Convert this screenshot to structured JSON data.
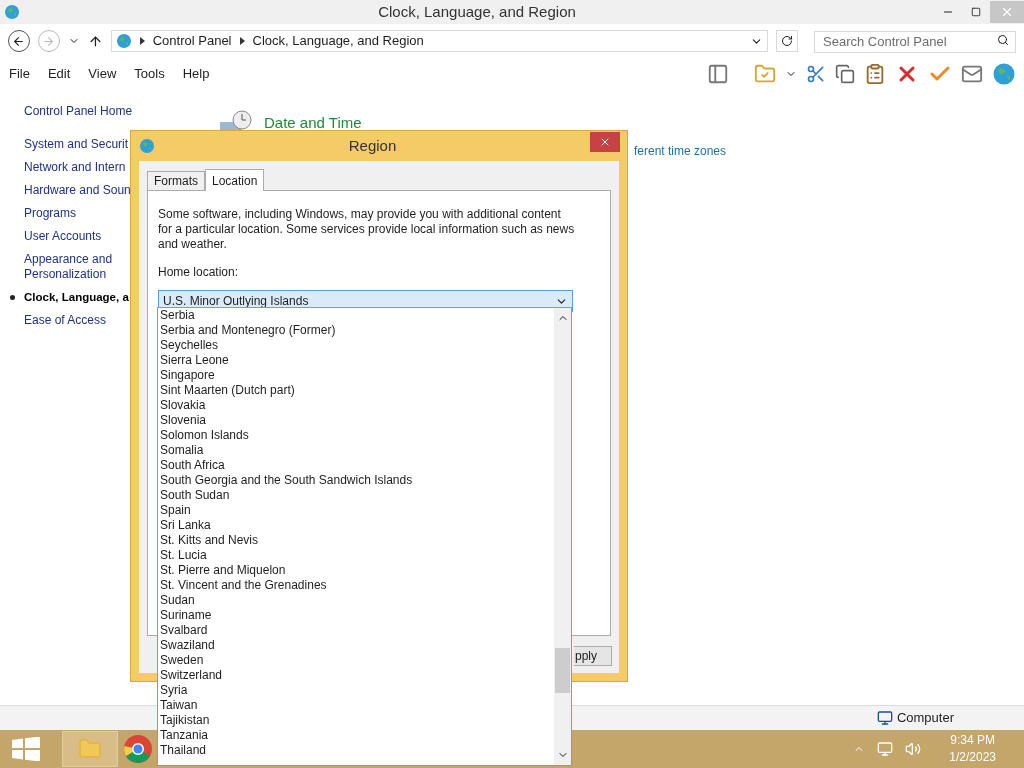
{
  "window": {
    "title": "Clock, Language, and Region"
  },
  "address_bar": {
    "breadcrumbs": [
      "Control Panel",
      "Clock, Language, and Region"
    ]
  },
  "search": {
    "placeholder": "Search Control Panel"
  },
  "menu": [
    "File",
    "Edit",
    "View",
    "Tools",
    "Help"
  ],
  "sidebar": {
    "items": [
      {
        "label": "Control Panel Home",
        "selected": false
      },
      {
        "label": "System and Securit",
        "selected": false
      },
      {
        "label": "Network and Intern",
        "selected": false
      },
      {
        "label": "Hardware and Soun",
        "selected": false
      },
      {
        "label": "Programs",
        "selected": false
      },
      {
        "label": "User Accounts",
        "selected": false
      },
      {
        "label": "Appearance and Personalization",
        "selected": false
      },
      {
        "label": "Clock, Language, a",
        "selected": true
      },
      {
        "label": "Ease of Access",
        "selected": false
      }
    ]
  },
  "main": {
    "heading": "Date and Time",
    "link": "ferent time zones"
  },
  "dialog": {
    "title": "Region",
    "tabs": [
      {
        "label": "Formats",
        "selected": false
      },
      {
        "label": "Location",
        "selected": true
      }
    ],
    "description": "Some software, including Windows, may provide you with additional content for a particular location. Some services provide local information such as news and weather.",
    "field_label": "Home location:",
    "combo": {
      "value": "U.S. Minor Outlying Islands",
      "expanded": true
    },
    "options": [
      "Serbia",
      "Serbia and Montenegro (Former)",
      "Seychelles",
      "Sierra Leone",
      "Singapore",
      "Sint Maarten (Dutch part)",
      "Slovakia",
      "Slovenia",
      "Solomon Islands",
      "Somalia",
      "South Africa",
      "South Georgia and the South Sandwich Islands",
      "South Sudan",
      "Spain",
      "Sri Lanka",
      "St. Kitts and Nevis",
      "St. Lucia",
      "St. Pierre and Miquelon",
      "St. Vincent and the Grenadines",
      "Sudan",
      "Suriname",
      "Svalbard",
      "Swaziland",
      "Sweden",
      "Switzerland",
      "Syria",
      "Taiwan",
      "Tajikistan",
      "Tanzania",
      "Thailand"
    ],
    "button": "pply"
  },
  "status_bar": {
    "text": "Computer"
  },
  "taskbar": {
    "time": "9:34 PM",
    "date": "1/2/2023"
  }
}
